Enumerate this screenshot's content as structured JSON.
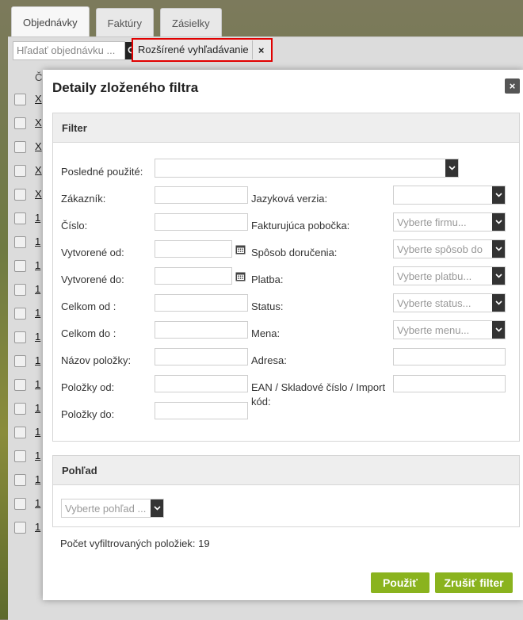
{
  "background": {
    "tabs": [
      {
        "label": "Objednávky",
        "active": true
      },
      {
        "label": "Faktúry",
        "active": false
      },
      {
        "label": "Zásielky",
        "active": false
      }
    ],
    "search_placeholder": "Hľadať objednávku ...",
    "advanced_search_label": "Rozšírené vyhľadávanie",
    "advanced_close": "×",
    "column_header": "Č",
    "row_links": [
      "X",
      "X",
      "X",
      "X",
      "X",
      "1",
      "1",
      "1",
      "1",
      "1",
      "1",
      "1",
      "1",
      "1",
      "1",
      "1",
      "1",
      "1",
      "1"
    ]
  },
  "modal": {
    "title": "Detaily zloženého filtra",
    "close": "×",
    "filter": {
      "header": "Filter",
      "last_used_label": "Posledné použité:",
      "left_fields": [
        {
          "label": "Zákazník:"
        },
        {
          "label": "Číslo:"
        },
        {
          "label": "Vytvorené od:"
        },
        {
          "label": "Vytvorené do:"
        },
        {
          "label": "Celkom od :"
        },
        {
          "label": "Celkom do :"
        },
        {
          "label": "Názov položky:"
        },
        {
          "label": "Položky od:"
        },
        {
          "label": "Položky do:"
        }
      ],
      "right_fields": [
        {
          "label": "Jazyková verzia:",
          "placeholder": ""
        },
        {
          "label": "Fakturujúca pobočka:",
          "placeholder": "Vyberte firmu..."
        },
        {
          "label": "Spôsob doručenia:",
          "placeholder": "Vyberte spôsob do"
        },
        {
          "label": "Platba:",
          "placeholder": "Vyberte platbu..."
        },
        {
          "label": "Status:",
          "placeholder": "Vyberte status..."
        },
        {
          "label": "Mena:",
          "placeholder": "Vyberte menu..."
        },
        {
          "label": "Adresa:",
          "placeholder": ""
        },
        {
          "label_line1": "EAN / Skladové číslo / Import",
          "label_line2": "kód:"
        }
      ]
    },
    "view": {
      "header": "Pohľad",
      "placeholder": "Vyberte pohľad ..."
    },
    "count_text": "Počet vyfiltrovaných položiek: 19",
    "apply_label": "Použiť",
    "cancel_label": "Zrušiť filter"
  },
  "colors": {
    "highlight_border": "#e00000",
    "button_green": "#8ab31e",
    "dark_control": "#333333"
  }
}
